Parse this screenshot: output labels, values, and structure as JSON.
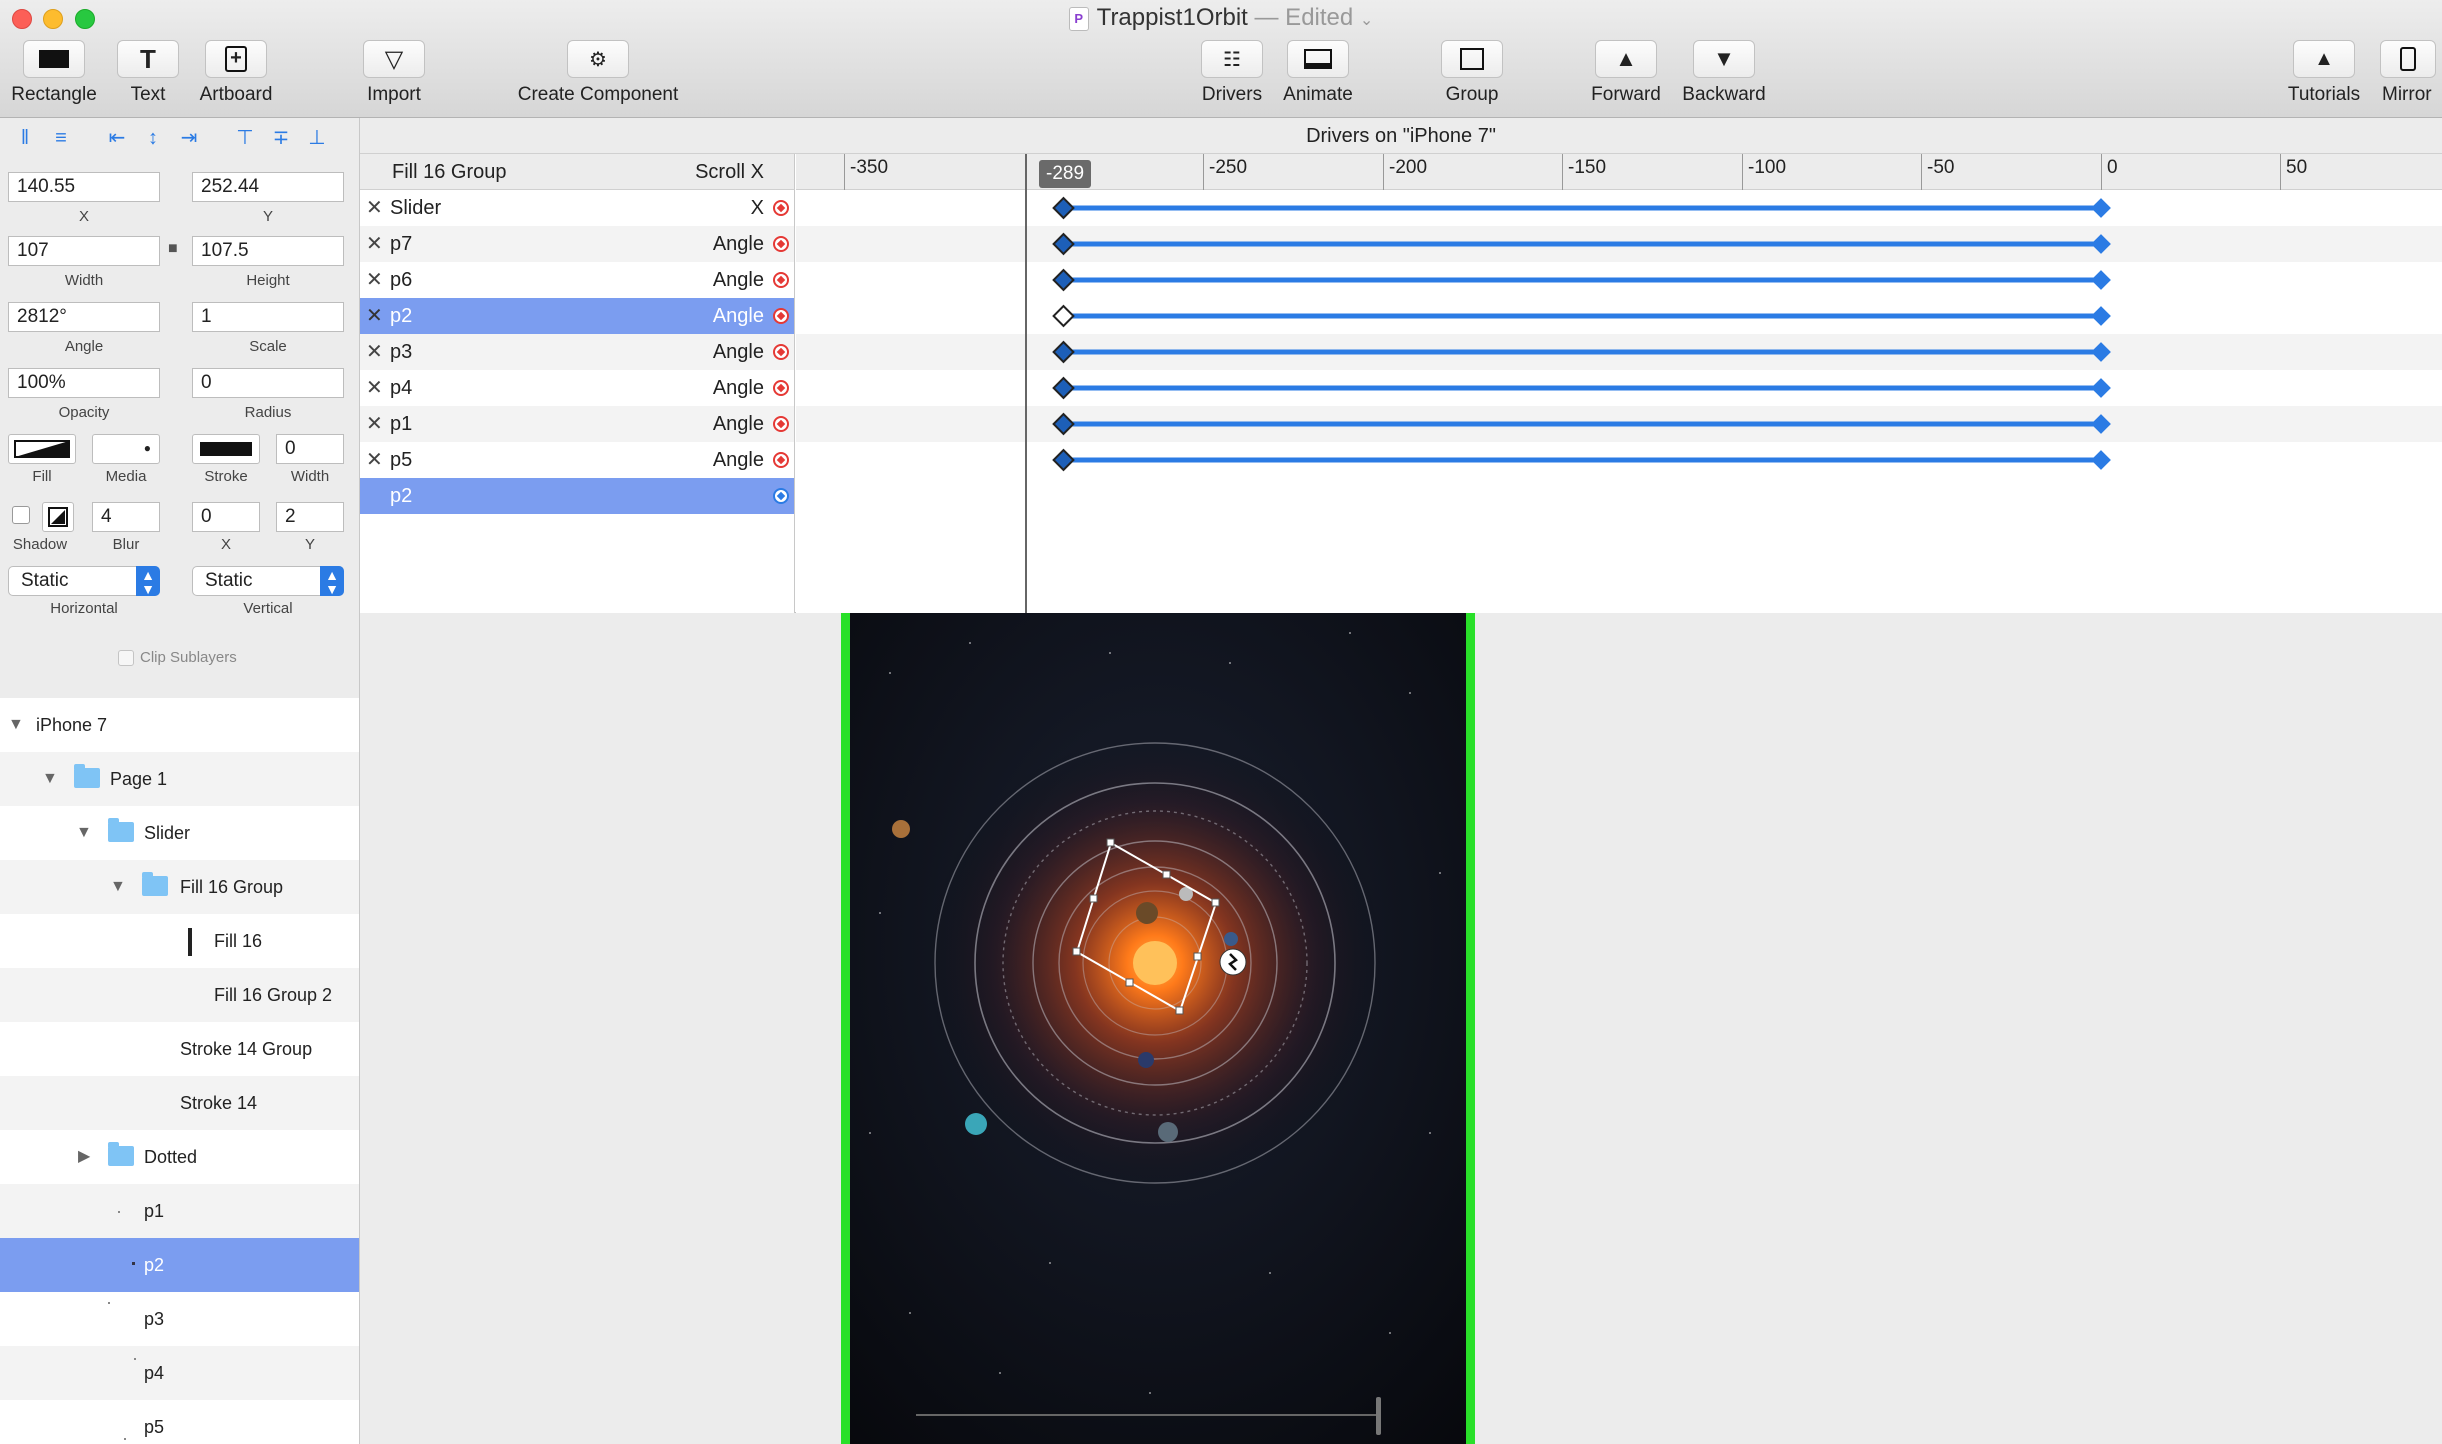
{
  "window": {
    "title": "Trappist1Orbit",
    "edited_text": "— Edited",
    "doc_icon": "P"
  },
  "toolbar": {
    "rectangle": "Rectangle",
    "text": "Text",
    "artboard": "Artboard",
    "import": "Import",
    "create_component": "Create Component",
    "drivers": "Drivers",
    "animate": "Animate",
    "group": "Group",
    "forward": "Forward",
    "backward": "Backward",
    "tutorials": "Tutorials",
    "mirror": "Mirror"
  },
  "inspector": {
    "x": {
      "value": "140.55",
      "label": "X"
    },
    "y": {
      "value": "252.44",
      "label": "Y"
    },
    "width": {
      "value": "107",
      "label": "Width"
    },
    "height": {
      "value": "107.5",
      "label": "Height"
    },
    "angle": {
      "value": "2812°",
      "label": "Angle"
    },
    "scale": {
      "value": "1",
      "label": "Scale"
    },
    "opacity": {
      "value": "100%",
      "label": "Opacity"
    },
    "radius": {
      "value": "0",
      "label": "Radius"
    },
    "fill_label": "Fill",
    "media_label": "Media",
    "stroke_label": "Stroke",
    "stroke_width": {
      "value": "0",
      "label": "Width"
    },
    "shadow_label": "Shadow",
    "blur": {
      "value": "4",
      "label": "Blur"
    },
    "shadow_x": {
      "value": "0",
      "label": "X"
    },
    "shadow_y": {
      "value": "2",
      "label": "Y"
    },
    "horizontal": {
      "value": "Static",
      "label": "Horizontal"
    },
    "vertical": {
      "value": "Static",
      "label": "Vertical"
    },
    "clip_sublayers": "Clip Sublayers"
  },
  "layers": [
    {
      "name": "iPhone 7"
    },
    {
      "name": "Page 1"
    },
    {
      "name": "Slider"
    },
    {
      "name": "Fill 16 Group"
    },
    {
      "name": "Fill 16"
    },
    {
      "name": "Fill 16 Group 2"
    },
    {
      "name": "Stroke 14 Group"
    },
    {
      "name": "Stroke 14"
    },
    {
      "name": "Dotted"
    },
    {
      "name": "p1"
    },
    {
      "name": "p2"
    },
    {
      "name": "p3"
    },
    {
      "name": "p4"
    },
    {
      "name": "p5"
    }
  ],
  "drivers": {
    "title": "Drivers on \"iPhone 7\"",
    "header_name": "Fill 16 Group",
    "header_prop": "Scroll X",
    "playhead_value": "-289",
    "ruler_ticks": [
      "-350",
      "-250",
      "-200",
      "-150",
      "-100",
      "-50",
      "0",
      "50"
    ],
    "tracks": [
      {
        "name": "Slider",
        "prop": "X"
      },
      {
        "name": "p7",
        "prop": "Angle"
      },
      {
        "name": "p6",
        "prop": "Angle"
      },
      {
        "name": "p2",
        "prop": "Angle"
      },
      {
        "name": "p3",
        "prop": "Angle"
      },
      {
        "name": "p4",
        "prop": "Angle"
      },
      {
        "name": "p1",
        "prop": "Angle"
      },
      {
        "name": "p5",
        "prop": "Angle"
      },
      {
        "name": "p2",
        "prop": ""
      }
    ],
    "keyframe_start": -289,
    "keyframe_end": 0
  },
  "colors": {
    "accent": "#2b7be4",
    "selection": "#7b9df0",
    "keyframe_red": "#e53935",
    "artboard_border": "#29e029"
  }
}
